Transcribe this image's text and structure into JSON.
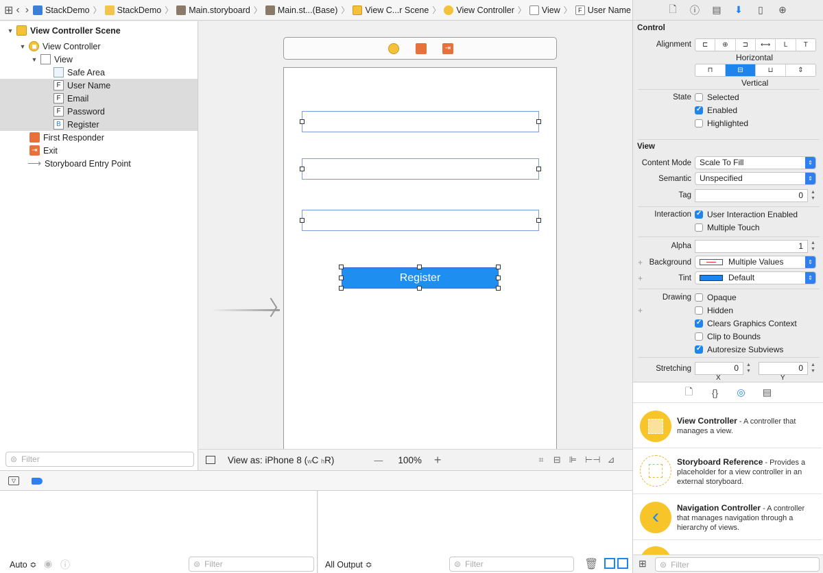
{
  "jumpbar": {
    "crumbs": [
      "StackDemo",
      "StackDemo",
      "Main.storyboard",
      "Main.st...(Base)",
      "View C...r Scene",
      "View Controller",
      "View",
      "User Name"
    ]
  },
  "outline": {
    "items": [
      {
        "label": "View Controller Scene",
        "icon": "scene-icon",
        "bold": true
      },
      {
        "label": "View Controller",
        "icon": "view-controller-icon"
      },
      {
        "label": "View",
        "icon": "view-icon"
      },
      {
        "label": "Safe Area",
        "icon": "safe-area-icon"
      },
      {
        "label": "User Name",
        "icon": "F"
      },
      {
        "label": "Email",
        "icon": "F"
      },
      {
        "label": "Password",
        "icon": "F"
      },
      {
        "label": "Register",
        "icon": "B"
      },
      {
        "label": "First Responder",
        "icon": "first-responder-icon"
      },
      {
        "label": "Exit",
        "icon": "exit-icon"
      },
      {
        "label": "Storyboard Entry Point",
        "icon": "arrow-icon"
      }
    ],
    "filter_placeholder": "Filter"
  },
  "canvas": {
    "button_label": "Register",
    "view_as": "View as: iPhone 8 (",
    "size_class_w": "w",
    "size_class_c": "C",
    "size_class_h": "h",
    "size_class_r": "R",
    "view_as_close": ")",
    "zoom": "100%",
    "zoom_minus": "—",
    "zoom_plus": "+"
  },
  "debug": {
    "auto_label": "Auto ≎",
    "all_output_label": "All Output ≎",
    "filter_placeholder": "Filter"
  },
  "inspector": {
    "control_title": "Control",
    "alignment_label": "Alignment",
    "horizontal_label": "Horizontal",
    "vertical_label": "Vertical",
    "state_label": "State",
    "states": [
      {
        "label": "Selected",
        "checked": false
      },
      {
        "label": "Enabled",
        "checked": true
      },
      {
        "label": "Highlighted",
        "checked": false
      }
    ],
    "view_title": "View",
    "content_mode_label": "Content Mode",
    "content_mode_value": "Scale To Fill",
    "semantic_label": "Semantic",
    "semantic_value": "Unspecified",
    "tag_label": "Tag",
    "tag_value": "0",
    "interaction_label": "Interaction",
    "interactions": [
      {
        "label": "User Interaction Enabled",
        "checked": true
      },
      {
        "label": "Multiple Touch",
        "checked": false
      }
    ],
    "alpha_label": "Alpha",
    "alpha_value": "1",
    "background_label": "Background",
    "background_value": "Multiple Values",
    "tint_label": "Tint",
    "tint_value": "Default",
    "drawing_label": "Drawing",
    "drawing": [
      {
        "label": "Opaque",
        "checked": false
      },
      {
        "label": "Hidden",
        "checked": false
      },
      {
        "label": "Clears Graphics Context",
        "checked": true
      },
      {
        "label": "Clip to Bounds",
        "checked": false
      },
      {
        "label": "Autoresize Subviews",
        "checked": true
      }
    ],
    "stretching_label": "Stretching",
    "stretch_x": "0",
    "stretch_y": "0",
    "x_label": "X",
    "y_label": "Y"
  },
  "library": {
    "items": [
      {
        "title": "View Controller",
        "desc": " - A controller that manages a view."
      },
      {
        "title": "Storyboard Reference",
        "desc": " - Provides a placeholder for a view controller in an external storyboard."
      },
      {
        "title": "Navigation Controller",
        "desc": " - A controller that manages navigation through a hierarchy of views."
      }
    ],
    "filter_placeholder": "Filter"
  },
  "colors": {
    "accent": "#1e84ee",
    "button_blue": "#1f8ef1",
    "vc_yellow": "#f3c13a",
    "responder_orange": "#e8703a"
  }
}
